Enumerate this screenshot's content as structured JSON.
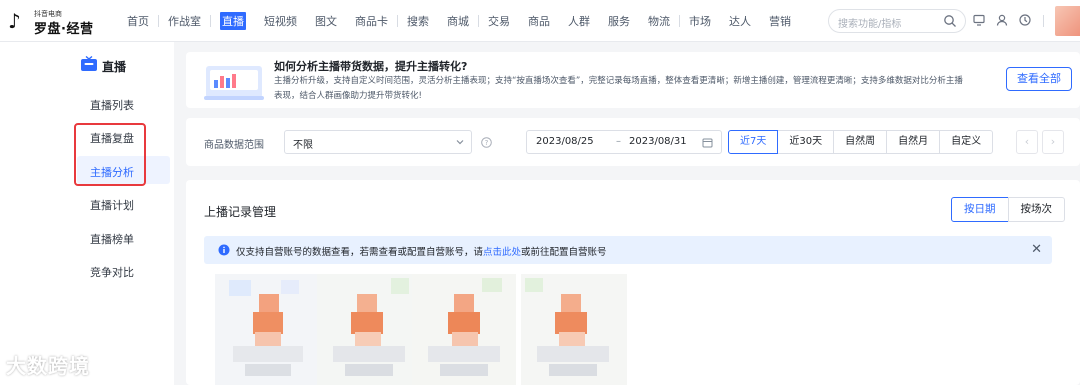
{
  "logo": {
    "sub": "抖音电商",
    "main": "罗盘·经营"
  },
  "nav": [
    "首页",
    "作战室",
    "直播",
    "短视频",
    "图文",
    "商品卡",
    "搜索",
    "商城",
    "交易",
    "商品",
    "人群",
    "服务",
    "物流",
    "市场",
    "达人",
    "营销"
  ],
  "nav_active": "直播",
  "search": {
    "placeholder": "搜索功能/指标"
  },
  "sidebar": {
    "header": "直播",
    "items": [
      "直播列表",
      "直播复盘",
      "主播分析",
      "直播计划",
      "直播榜单",
      "竞争对比"
    ],
    "active": "主播分析"
  },
  "banner": {
    "title": "如何分析主播带货数据，提升主播转化?",
    "desc": "主播分析升级，支持自定义时间范围，灵活分析主播表现；支持“按直播场次查看”，完整记录每场直播，整体查看更清晰；新增主播创建，管理流程更清晰；支持多维数据对比分析主播表现，结合人群画像助力提升带货转化!",
    "button": "查看全部"
  },
  "filter": {
    "label": "商品数据范围",
    "select_value": "不限",
    "date_start": "2023/08/25",
    "date_sep": "–",
    "date_end": "2023/08/31",
    "periods": [
      "近7天",
      "近30天",
      "自然周",
      "自然月",
      "自定义"
    ],
    "active_period": "近7天"
  },
  "records": {
    "title": "上播记录管理",
    "toggle": [
      "按日期",
      "按场次"
    ],
    "active_toggle": "按日期",
    "notice_prefix": "仅支持自营账号的数据查看，若需查看或配置自营账号，请",
    "notice_link": "点击此处",
    "notice_suffix": "或前往配置自营账号"
  },
  "watermark": "大数跨境",
  "colors": {
    "accent": "#2f6bff",
    "highlight_box": "#e8393d",
    "notice_bg": "#e8f1ff"
  }
}
